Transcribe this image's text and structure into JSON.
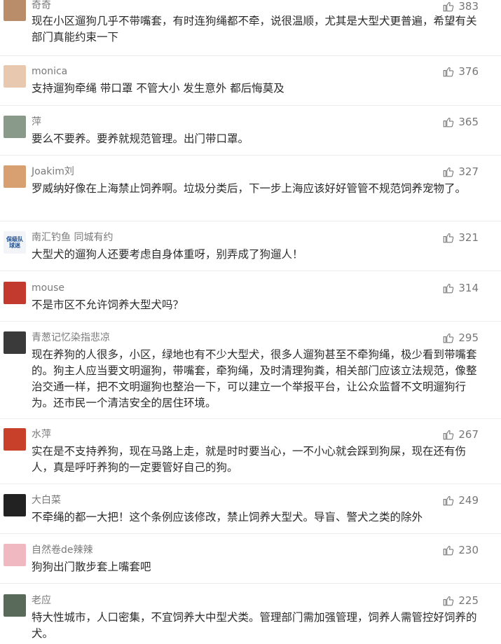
{
  "comments": [
    {
      "user": "奇奇",
      "likes": "383",
      "text": "现在小区遛狗几乎不带嘴套，有时连狗绳都不牵，说很温顺，尤其是大型犬更普遍，希望有关部门真能约束一下",
      "avatar_color": "#b98c6a"
    },
    {
      "user": "monica",
      "likes": "376",
      "text": "支持遛狗牵绳 带口罩 不管大小 发生意外 都后悔莫及",
      "avatar_color": "#e8c9b0"
    },
    {
      "user": "萍",
      "likes": "365",
      "text": "要么不要养。要养就规范管理。出门带口罩。",
      "avatar_color": "#8a9a8a"
    },
    {
      "user": "Joakim刘",
      "likes": "327",
      "text": "罗威纳好像在上海禁止饲养啊。垃圾分类后，下一步上海应该好好管管不规范饲养宠物了。",
      "avatar_color": "#d8a070"
    },
    {
      "user": "南汇钓鱼 同城有约",
      "likes": "321",
      "text": "大型犬的遛狗人还要考虑自身体重呀，别弄成了狗遛人！",
      "avatar_color": "#1e4f8c",
      "avatar_text": "保级队球迷"
    },
    {
      "user": "mouse",
      "likes": "314",
      "text": "不是市区不允许饲养大型犬吗？",
      "avatar_color": "#c23a2e"
    },
    {
      "user": "青葱记忆染指悲凉",
      "likes": "295",
      "text": "现在养狗的人很多，小区，绿地也有不少大型犬，很多人遛狗甚至不牵狗绳，极少看到带嘴套的。狗主人应当要文明遛狗，带嘴套，牵狗绳，及时清理狗粪，相关部门应该立法规范，像整治交通一样，把不文明遛狗也整治一下，可以建立一个举报平台，让公众监督不文明遛狗行为。还市民一个清洁安全的居住环境。",
      "avatar_color": "#3a3a3a"
    },
    {
      "user": "水萍",
      "likes": "267",
      "text": "实在是不支持养狗，现在马路上走，就是时时要当心，一不小心就会踩到狗屎，现在还有伤人，真是呼吁养狗的一定要管好自己的狗。",
      "avatar_color": "#c8402a"
    },
    {
      "user": "大白菜",
      "likes": "249",
      "text": "不牵绳的都一大把！这个条例应该修改，禁止饲养大型犬。导盲、警犬之类的除外",
      "avatar_color": "#222222"
    },
    {
      "user": "自然卷de辣辣",
      "likes": "230",
      "text": "狗狗出门散步套上嘴套吧",
      "avatar_color": "#f0b8c0"
    },
    {
      "user": "老应",
      "likes": "225",
      "text": "特大性城市，人口密集，不宜饲养大中型犬类。管理部门需加强管理，饲养人需管控好饲养的犬。",
      "avatar_color": "#5a6a5a"
    }
  ]
}
